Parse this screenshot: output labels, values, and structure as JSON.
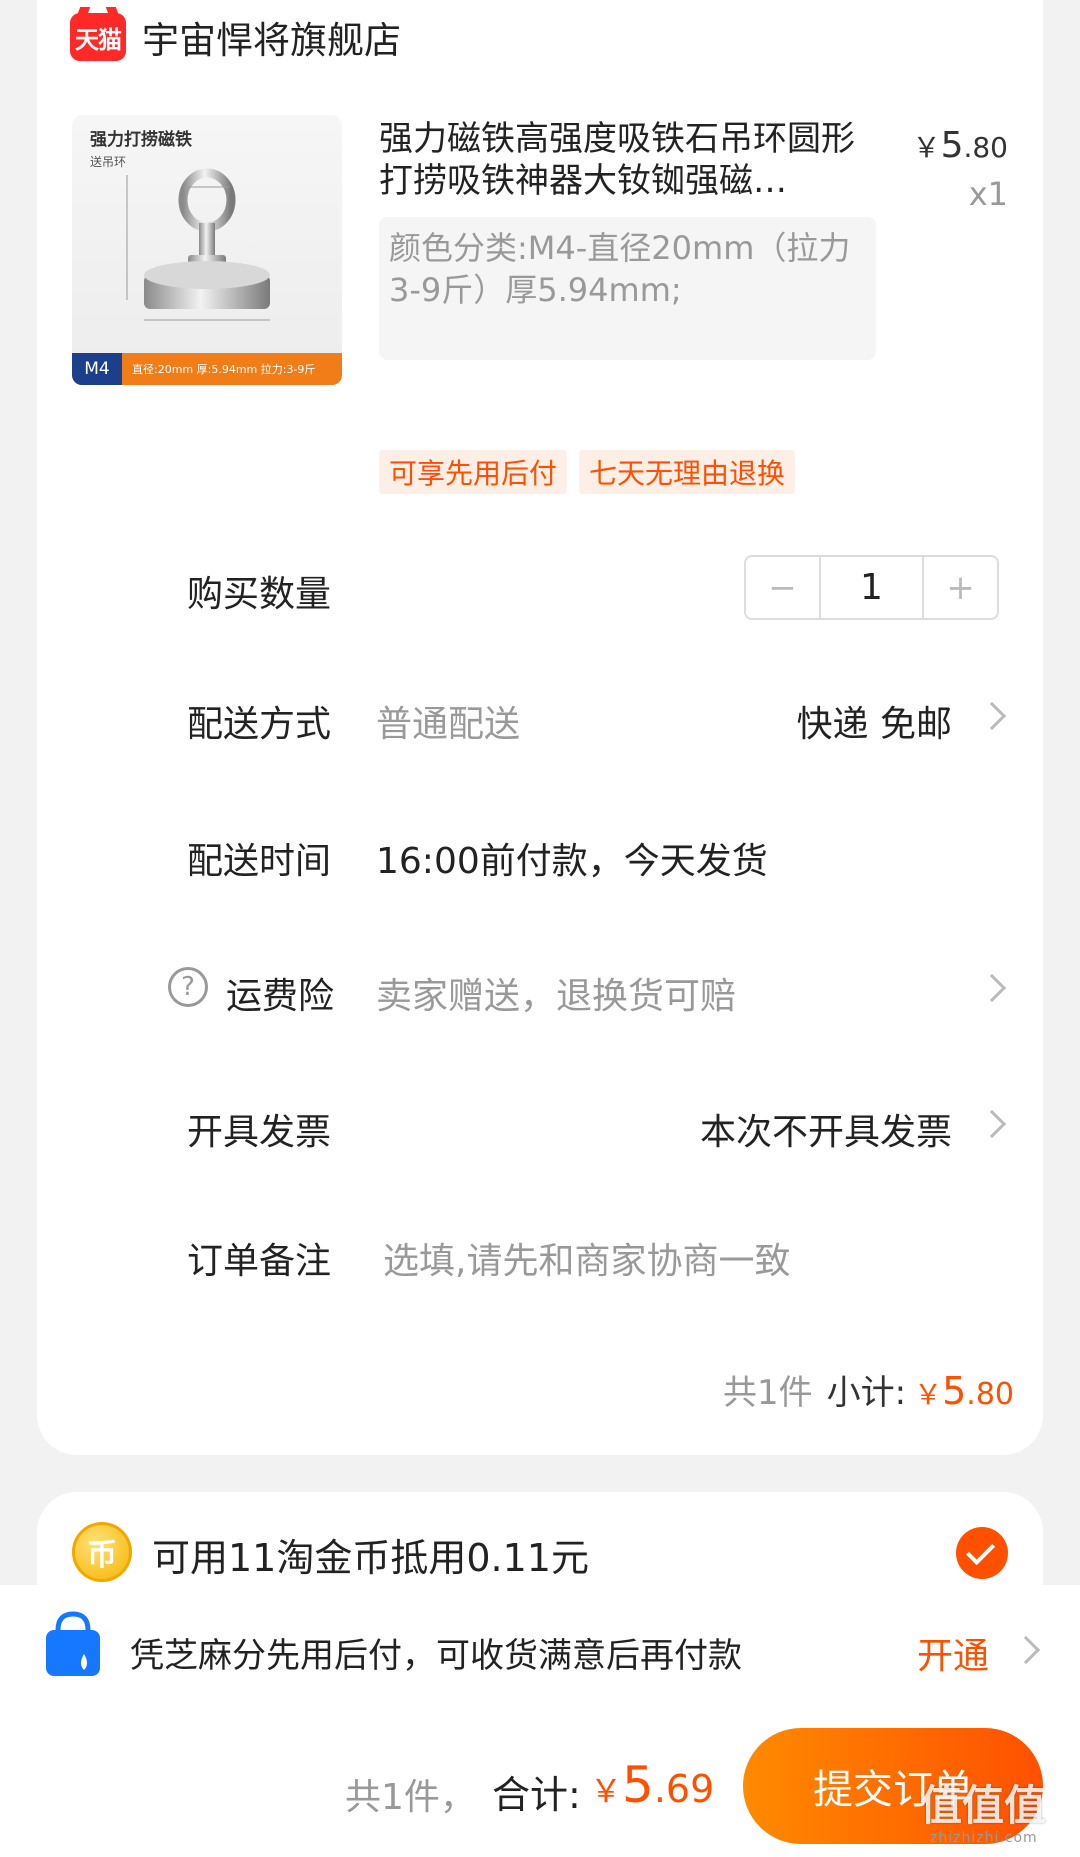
{
  "store": {
    "badge": "天猫",
    "name": "宇宙悍将旗舰店"
  },
  "product": {
    "image_title": "强力打捞磁铁",
    "image_sub": "送吊环",
    "image_badge_model": "M4",
    "image_badge_text": "直径:20mm 厚:5.94mm 拉力:3-9斤",
    "title": "强力磁铁高强度吸铁石吊环圆形打捞吸铁神器大钕铷强磁…",
    "spec": "颜色分类:M4-直径20mm（拉力3-9斤）厚5.94mm;",
    "price_symbol": "￥",
    "price_int": "5",
    "price_dec": ".80",
    "quantity_mark": "x1"
  },
  "service_tags": [
    "可享先用后付",
    "七天无理由退换"
  ],
  "quantity": {
    "label": "购买数量",
    "minus": "−",
    "value": "1",
    "plus": "+"
  },
  "delivery_method": {
    "label": "配送方式",
    "value": "普通配送",
    "detail": "快递 免邮"
  },
  "delivery_time": {
    "label": "配送时间",
    "value": "16:00前付款，今天发货"
  },
  "shipping_insurance": {
    "label": "运费险",
    "help": "?",
    "value": "卖家赠送，退换货可赔"
  },
  "invoice": {
    "label": "开具发票",
    "value": "本次不开具发票"
  },
  "note": {
    "label": "订单备注",
    "placeholder": "选填,请先和商家协商一致"
  },
  "subtotal": {
    "count": "共1件",
    "label": "小计:",
    "symbol": "￥",
    "int": "5",
    "dec": ".80"
  },
  "coins": {
    "icon": "币",
    "text": "可用11淘金币抵用0.11元",
    "checked": true
  },
  "pay_later": {
    "text": "凭芝麻分先用后付，可收货满意后再付款",
    "action": "开通"
  },
  "footer": {
    "count": "共1件，",
    "total_label": "合计:",
    "symbol": "￥",
    "total_int": "5",
    "total_dec": ".69",
    "submit": "提交订单"
  },
  "watermark": {
    "text": "值值值",
    "url": "zhizhizhi.com"
  },
  "colors": {
    "accent": "#ff5000",
    "tmall": "#ff2a27",
    "muted": "#999999"
  }
}
